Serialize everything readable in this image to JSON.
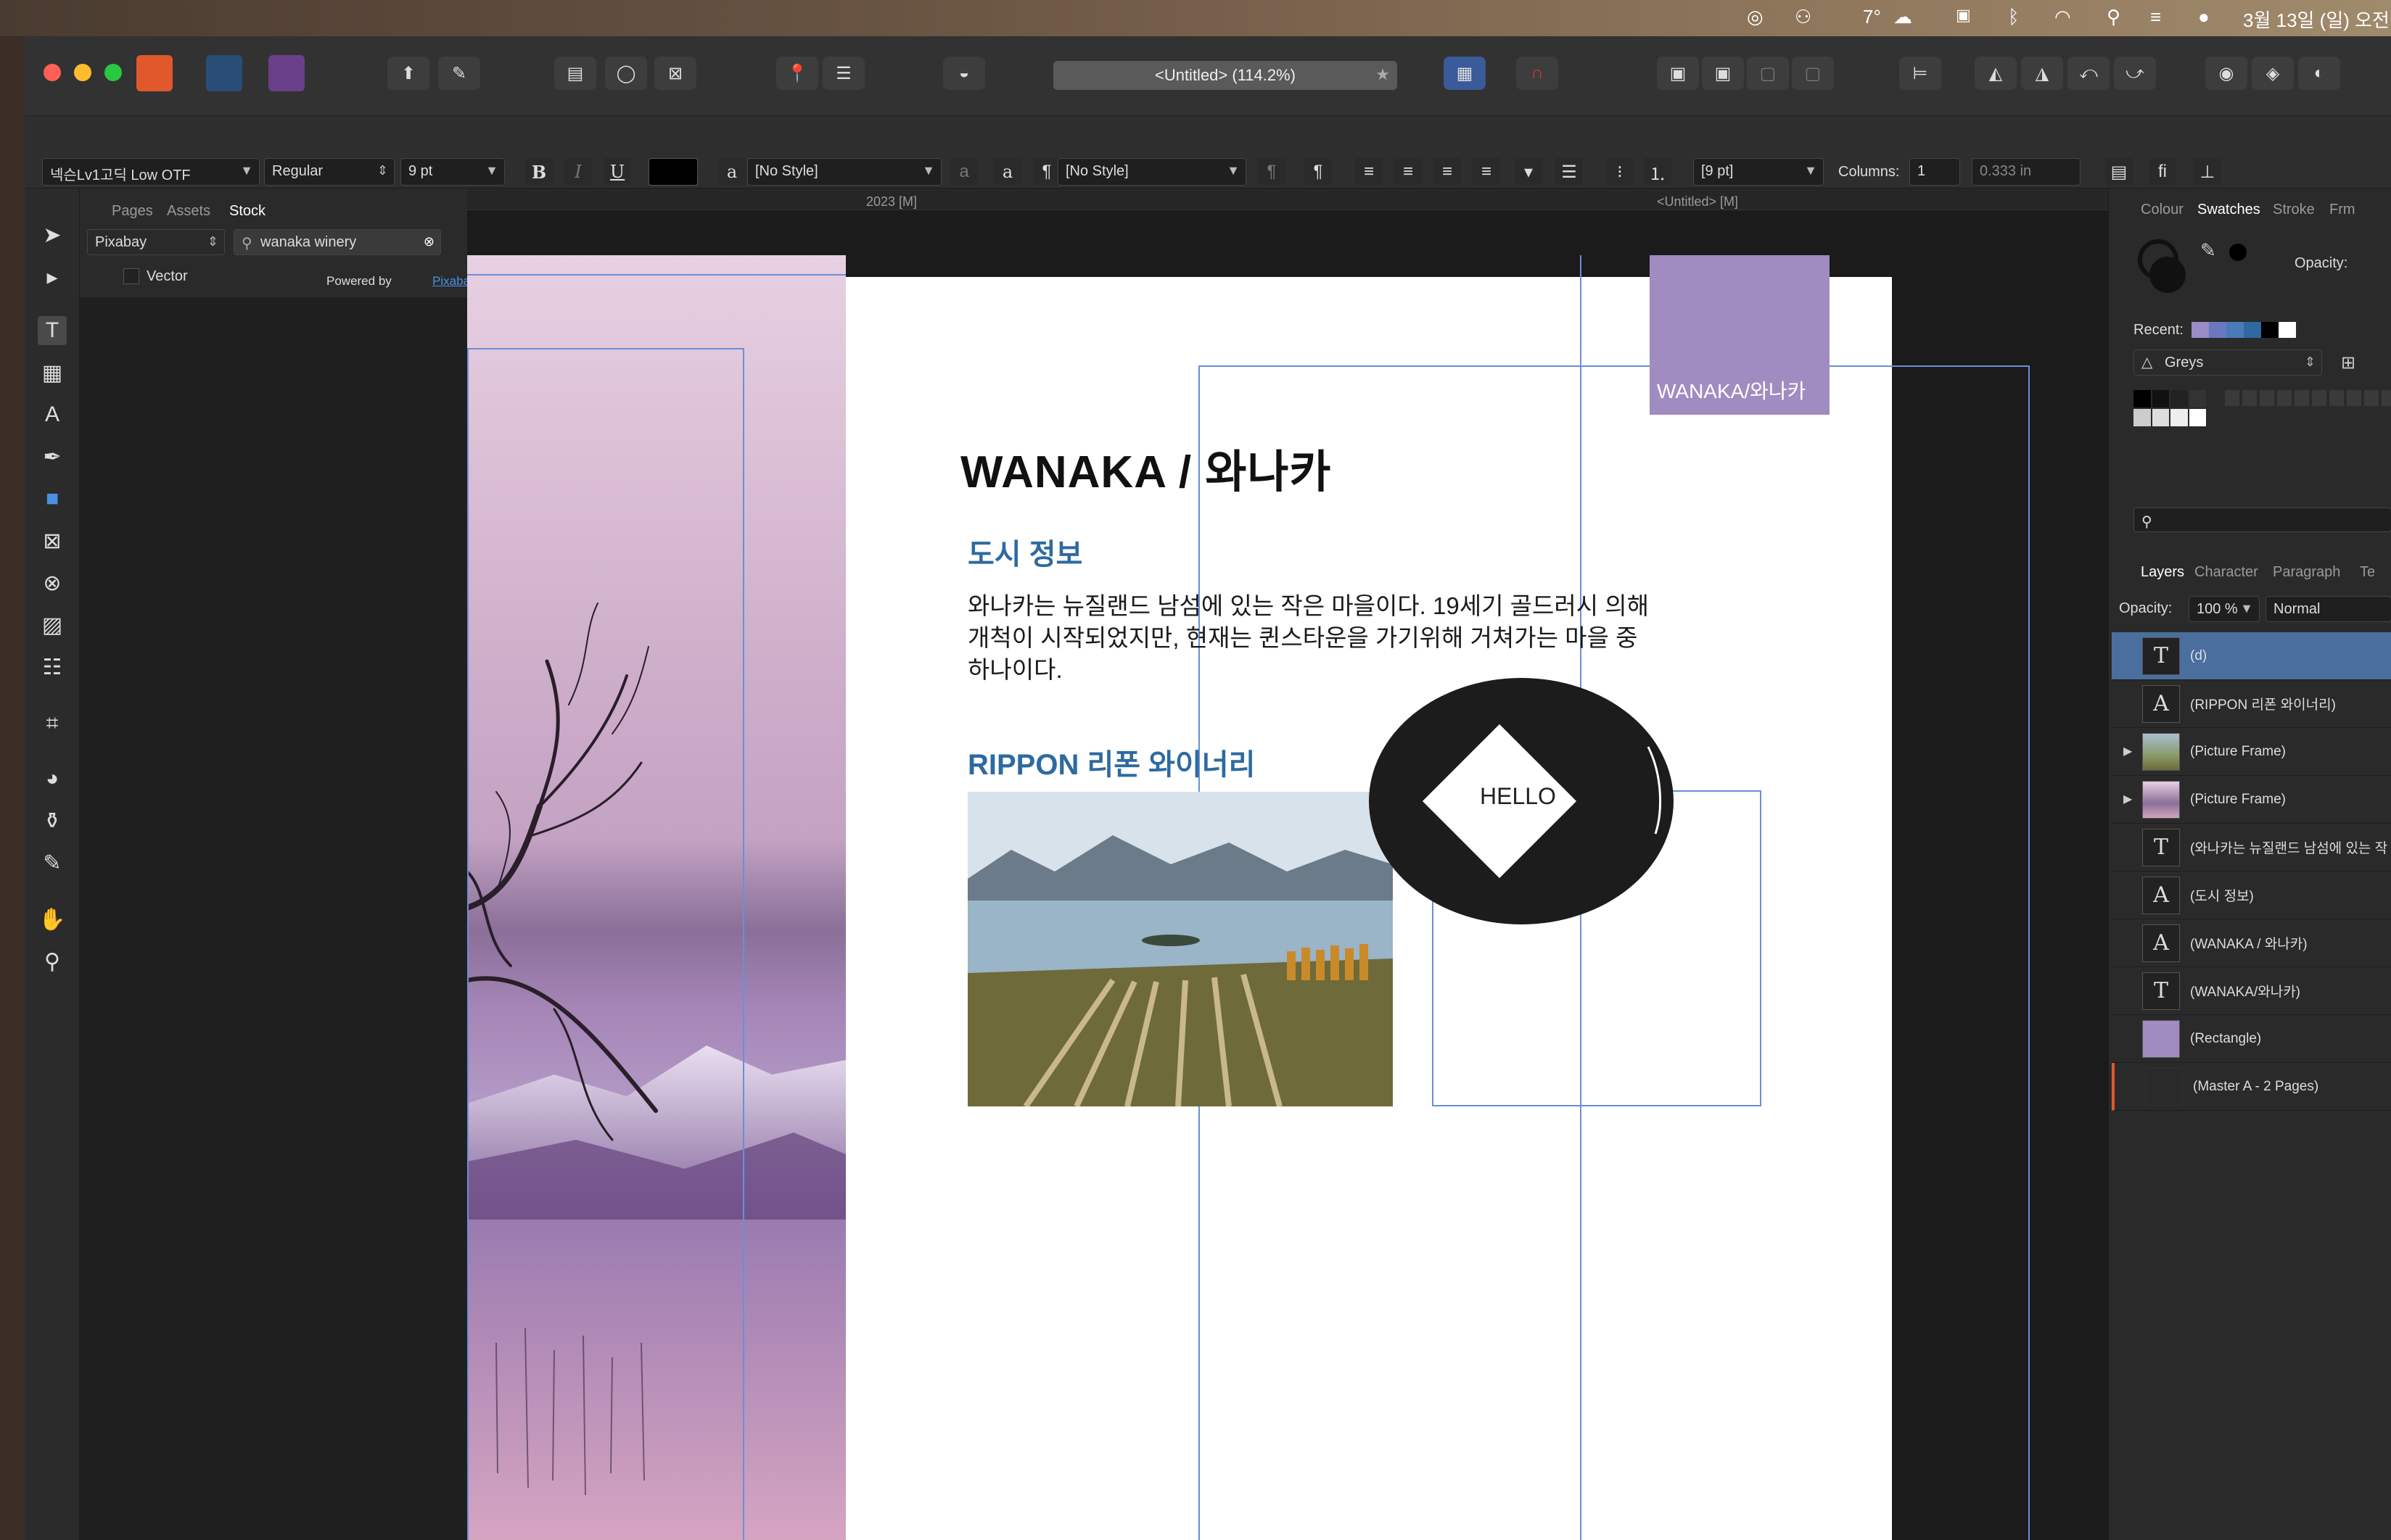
{
  "menubar": {
    "temperature": "7°",
    "datetime": "3월 13일 (일) 오전"
  },
  "titlebar": {
    "doc_title": "<Untitled> (114.2%)"
  },
  "context_toolbar": {
    "font_family": "넥슨Lv1고딕 Low OTF",
    "font_style": "Regular",
    "font_size": "9 pt",
    "bold": "B",
    "italic": "I",
    "underline": "U",
    "char_style_icon": "a",
    "char_style": "[No Style]",
    "para_style": "[No Style]",
    "leading": "[9 pt]",
    "columns_label": "Columns:",
    "columns_value": "1",
    "gutter_value": "0.333 in"
  },
  "left_panel": {
    "tabs": [
      "Pages",
      "Assets",
      "Stock"
    ],
    "source": "Pixabay",
    "search_value": "wanaka winery",
    "vector_label": "Vector",
    "powered_by": "Powered by",
    "powered_link": "Pixabay"
  },
  "canvas": {
    "ruler_left": "2023 [M]",
    "ruler_right": "<Untitled> [M]"
  },
  "document": {
    "title": "WANAKA / 와나카",
    "tag": "WANAKA/와나카",
    "section1": "도시 정보",
    "body_line1": "와나카는 뉴질랜드 남섬에 있는 작은 마을이다. 19세기 골드러시 의해",
    "body_line2": "개척이 시작되었지만, 현재는 퀸스타운을 가기위해 거쳐가는 마을 중",
    "body_line3": "하나이다.",
    "section2": "RIPPON 리폰 와이너리",
    "hello": "HELLO"
  },
  "right_panel": {
    "tabs_top": [
      "Colour",
      "Swatches",
      "Stroke",
      "Frm"
    ],
    "opacity_label": "Opacity:",
    "recent_label": "Recent:",
    "palette": "Greys",
    "tabs_layers": [
      "Layers",
      "Character",
      "Paragraph",
      "Te"
    ],
    "layers_opacity_label": "Opacity:",
    "layers_opacity": "100 %",
    "blend_mode": "Normal",
    "layers": [
      {
        "name": "(d)",
        "icon": "T"
      },
      {
        "name": "(RIPPON 리폰 와이너리)",
        "icon": "A"
      },
      {
        "name": "(Picture Frame)",
        "icon": "img"
      },
      {
        "name": "(Picture Frame)",
        "icon": "img2"
      },
      {
        "name": "(와나카는 뉴질랜드 남섬에 있는 작",
        "icon": "T"
      },
      {
        "name": "(도시 정보)",
        "icon": "A"
      },
      {
        "name": "(WANAKA / 와나카)",
        "icon": "A"
      },
      {
        "name": "(WANAKA/와나카)",
        "icon": "T"
      },
      {
        "name": "(Rectangle)",
        "icon": "rect"
      },
      {
        "name": "(Master A - 2 Pages)",
        "icon": "master"
      }
    ]
  },
  "colors": {
    "accent_purple": "#a08cc0",
    "heading_blue": "#2e6aa0",
    "selection_blue": "#4a6f9e"
  }
}
